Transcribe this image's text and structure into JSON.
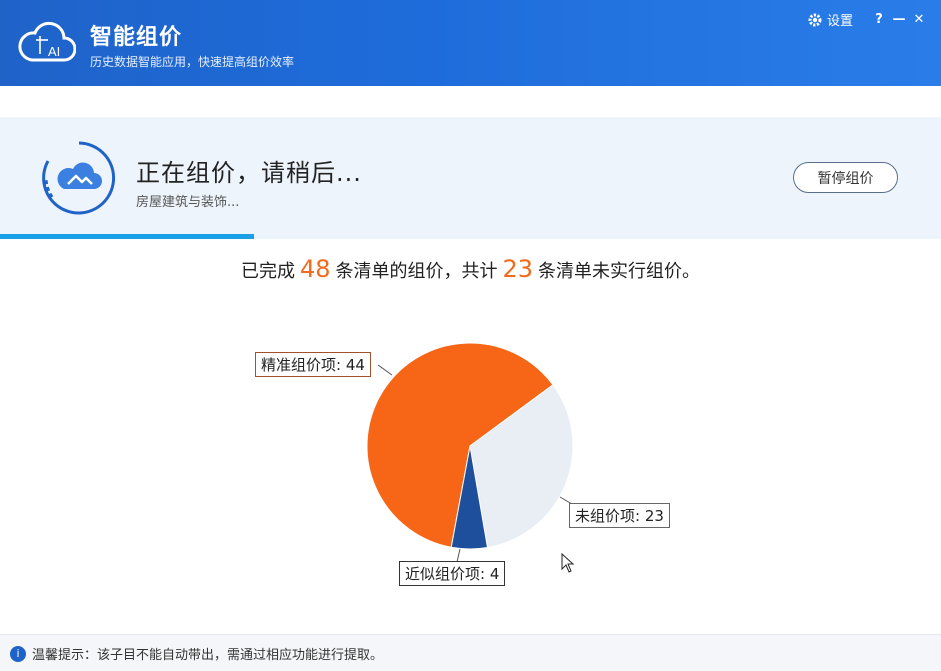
{
  "header": {
    "title": "智能组价",
    "subtitle": "历史数据智能应用，快速提高组价效率",
    "logo_icon": "ai-cloud-icon",
    "settings_label": "设置",
    "help_label": "?",
    "minimize_label": "—",
    "close_label": "✕"
  },
  "status": {
    "title": "正在组价，请稍后...",
    "subtitle": "房屋建筑与装饰...",
    "pause_button": "暂停组价",
    "progress_fraction": 0.27
  },
  "summary": {
    "prefix": "已完成",
    "completed": "48",
    "middle": "条清单的组价，共计",
    "unpriced": "23",
    "suffix": "条清单未实行组价。"
  },
  "chart_data": {
    "type": "pie",
    "slices": [
      {
        "name": "精准组价项",
        "value": 44,
        "color": "#f76617",
        "label": "精准组价项: 44"
      },
      {
        "name": "未组价项",
        "value": 23,
        "color": "#e8eef4",
        "label": "未组价项: 23"
      },
      {
        "name": "近似组价项",
        "value": 4,
        "color": "#1e4f9c",
        "label": "近似组价项: 4"
      }
    ]
  },
  "footer": {
    "message": "温馨提示：该子目不能自动带出，需通过相应功能进行提取。"
  },
  "colors": {
    "header_blue": "#1f63c9",
    "accent_orange": "#f26a1b",
    "progress_blue": "#18a1e6"
  }
}
